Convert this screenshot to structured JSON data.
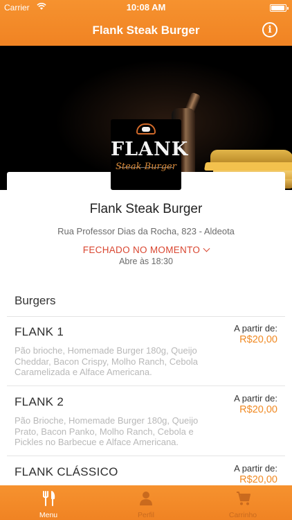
{
  "status_bar": {
    "carrier": "Carrier",
    "time": "10:08 AM"
  },
  "header": {
    "title": "Flank Steak Burger"
  },
  "logo": {
    "name": "FLANK",
    "subtitle": "Steak Burger"
  },
  "restaurant": {
    "name": "Flank Steak Burger",
    "address": "Rua Professor Dias da Rocha, 823 - Aldeota",
    "status": "FECHADO NO MOMENTO",
    "hours": "Abre às 18:30"
  },
  "menu": {
    "section_title": "Burgers",
    "items": [
      {
        "name": "FLANK 1",
        "description": "Pão brioche, Homemade Burger 180g, Queijo Cheddar, Bacon Crispy, Molho Ranch, Cebola Caramelizada e Alface Americana.",
        "from_label": "A partir de:",
        "price": "R$20,00"
      },
      {
        "name": "FLANK 2",
        "description": "Pão Brioche, Homemade Burger 180g, Queijo Prato, Bacon Panko, Molho Ranch, Cebola e Pickles no Barbecue e Alface Americana.",
        "from_label": "A partir de:",
        "price": "R$20,00"
      },
      {
        "name": "FLANK CLÁSSICO",
        "description": "",
        "from_label": "A partir de:",
        "price": "R$20,00"
      }
    ]
  },
  "tabbar": {
    "tabs": [
      {
        "label": "Menu",
        "icon": "fork-knife-icon",
        "active": true
      },
      {
        "label": "Perfil",
        "icon": "person-icon",
        "active": false
      },
      {
        "label": "Carrinho",
        "icon": "cart-icon",
        "active": false
      }
    ]
  },
  "colors": {
    "accent": "#f08323",
    "closed": "#d9452f",
    "price": "#f08a24"
  }
}
